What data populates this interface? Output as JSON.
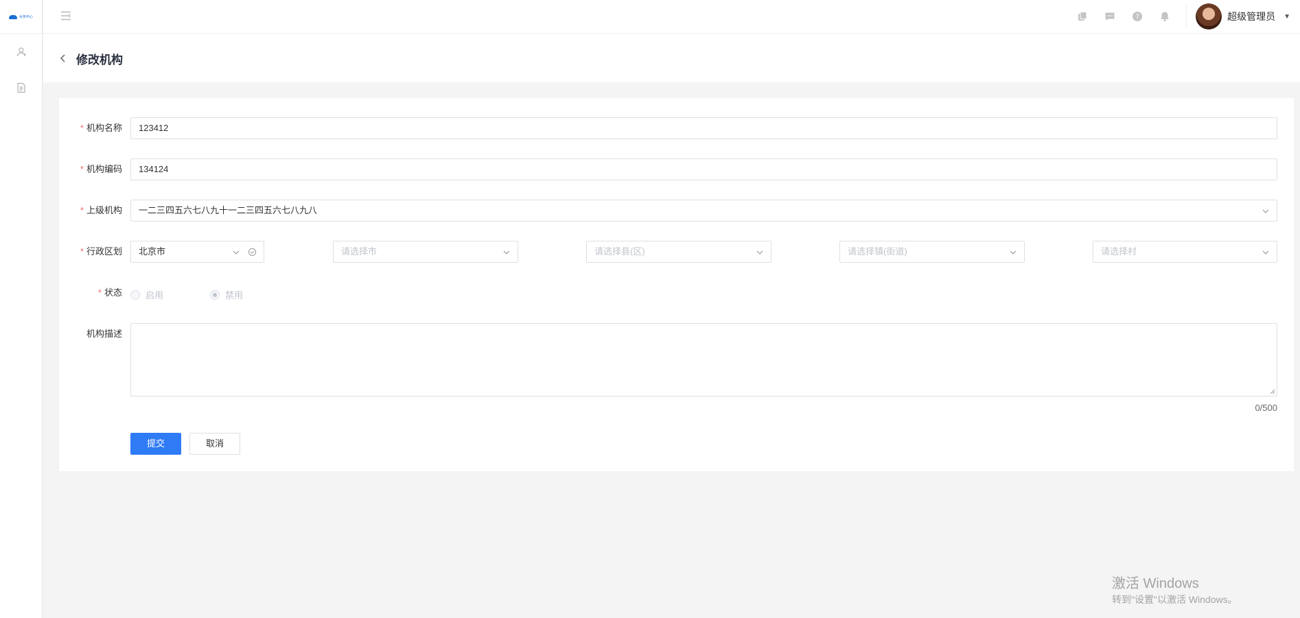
{
  "app": {
    "logo_text": "水务中心"
  },
  "header": {
    "username": "超级管理员"
  },
  "page": {
    "title": "修改机构"
  },
  "form": {
    "org_name": {
      "label": "机构名称",
      "value": "123412"
    },
    "org_code": {
      "label": "机构编码",
      "value": "134124"
    },
    "parent_org": {
      "label": "上级机构",
      "value": "一二三四五六七八九十一二三四五六七八九八"
    },
    "region": {
      "label": "行政区划",
      "province": "北京市",
      "city_placeholder": "请选择市",
      "county_placeholder": "请选择县(区)",
      "town_placeholder": "请选择镇(街道)",
      "village_placeholder": "请选择村"
    },
    "status": {
      "label": "状态",
      "option_enabled": "启用",
      "option_disabled": "禁用",
      "selected": "禁用"
    },
    "description": {
      "label": "机构描述",
      "value": "",
      "counter": "0/500"
    },
    "submit_label": "提交",
    "cancel_label": "取消",
    "required_mark": "*"
  },
  "watermark": {
    "line1": "激活 Windows",
    "line2": "转到\"设置\"以激活 Windows。"
  },
  "colors": {
    "primary": "#2f7bf5",
    "required": "#f56c6c",
    "background": "#f4f4f4"
  }
}
